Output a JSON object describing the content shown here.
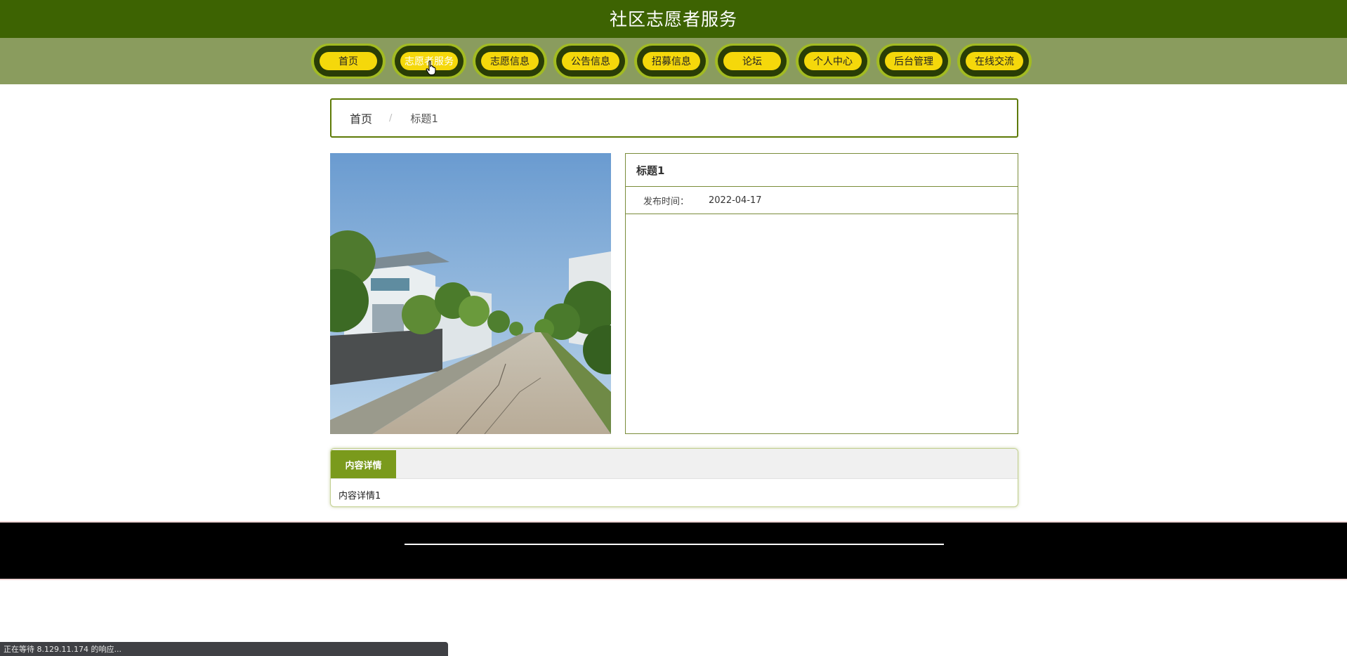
{
  "header": {
    "title": "社区志愿者服务"
  },
  "nav": {
    "items": [
      {
        "label": "首页"
      },
      {
        "label": "志愿者服务",
        "active": true
      },
      {
        "label": "志愿信息"
      },
      {
        "label": "公告信息"
      },
      {
        "label": "招募信息"
      },
      {
        "label": "论坛"
      },
      {
        "label": "个人中心"
      },
      {
        "label": "后台管理"
      },
      {
        "label": "在线交流"
      }
    ]
  },
  "breadcrumb": {
    "home": "首页",
    "separator": "/",
    "current": "标题1"
  },
  "detail": {
    "title": "标题1",
    "publish_label": "发布时间：",
    "publish_date": "2022-04-17",
    "image_alt": "village-road-photo"
  },
  "tabs": {
    "active_label": "内容详情",
    "content": "内容详情1"
  },
  "status_bar": {
    "text": "正在等待 8.129.11.174 的响应..."
  },
  "colors": {
    "header_bg": "#3d6302",
    "nav_bg": "#8a9c5e",
    "pill": "#f5d80b",
    "accent": "#7a9a1c",
    "footer_bg": "#000000"
  }
}
